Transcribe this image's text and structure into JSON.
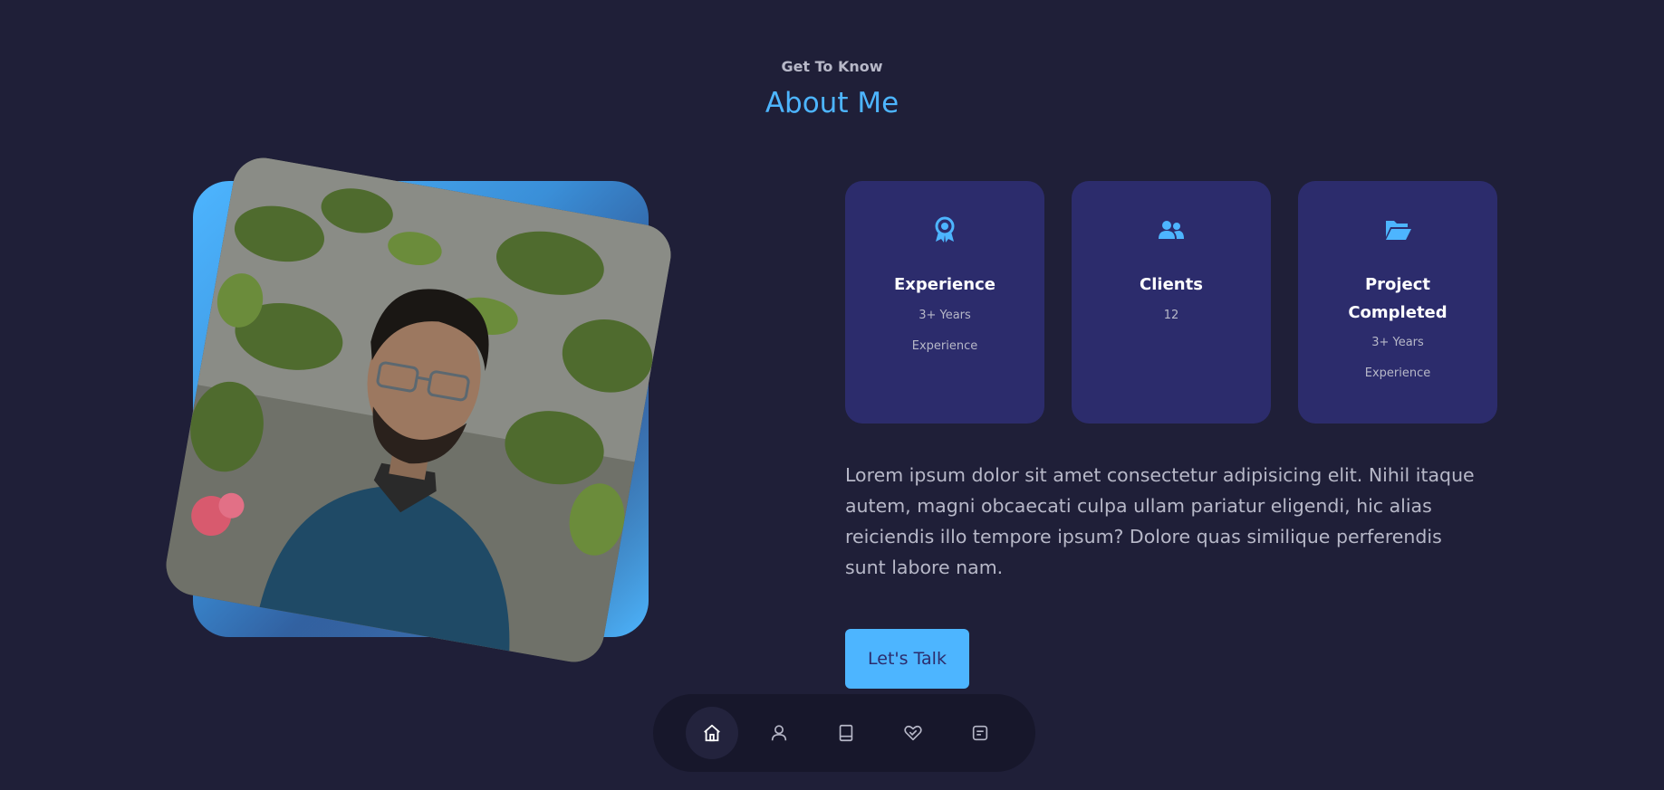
{
  "header": {
    "subtitle": "Get To Know",
    "title": "About Me"
  },
  "portrait": {
    "alt": "Portrait photo"
  },
  "cards": [
    {
      "icon": "award-icon",
      "title": "Experience",
      "lines": [
        "3+ Years",
        "Experience"
      ]
    },
    {
      "icon": "users-icon",
      "title": "Clients",
      "lines": [
        "12"
      ]
    },
    {
      "icon": "folder-open-icon",
      "title_line1": "Project",
      "title_line2": "Completed",
      "lines": [
        "3+ Years",
        "Experience"
      ]
    }
  ],
  "about": {
    "text": "Lorem ipsum dolor sit amet consectetur adipisicing elit. Nihil itaque autem, magni obcaecati culpa ullam pariatur eligendi, hic alias reiciendis illo tempore ipsum? Dolore quas similique perferendis sunt labore nam.",
    "button_label": "Let's Talk"
  },
  "nav": {
    "items": [
      {
        "icon": "home-icon",
        "active": true
      },
      {
        "icon": "user-icon",
        "active": false
      },
      {
        "icon": "book-icon",
        "active": false
      },
      {
        "icon": "services-icon",
        "active": false
      },
      {
        "icon": "message-icon",
        "active": false
      }
    ]
  },
  "colors": {
    "background": "#1f1f38",
    "primary": "#4db5ff",
    "card": "#2c2c6c",
    "text_light": "#b7b8c8"
  }
}
